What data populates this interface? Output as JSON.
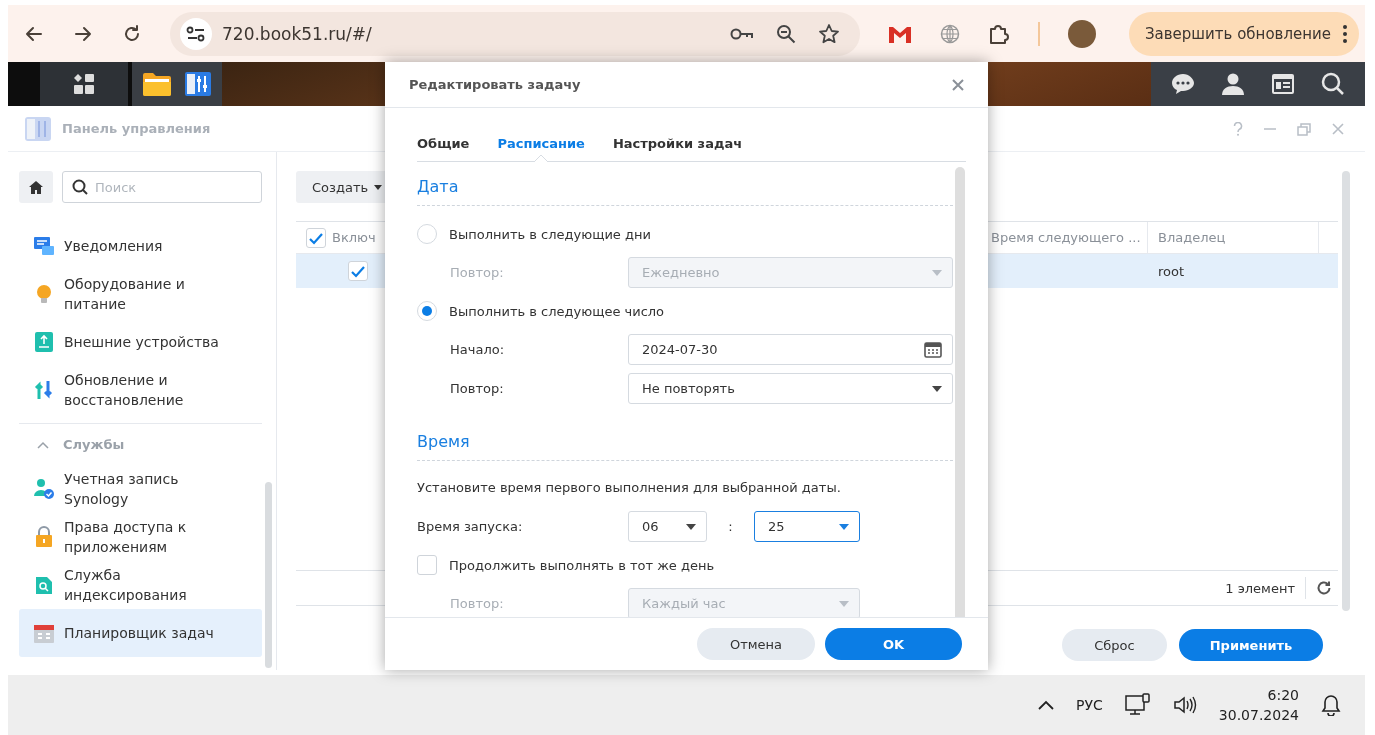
{
  "browser": {
    "url": "720.book51.ru/#/",
    "update_button": "Завершить обновление"
  },
  "control_panel": {
    "title": "Панель управления",
    "search": {
      "placeholder": "Поиск"
    },
    "sidebar": [
      {
        "kind": "item",
        "label": "Уведомления",
        "selected": false
      },
      {
        "kind": "item",
        "label": "Оборудование и питание",
        "selected": false
      },
      {
        "kind": "item",
        "label": "Внешние устройства",
        "selected": false
      },
      {
        "kind": "item",
        "label": "Обновление и восстановление",
        "selected": false
      },
      {
        "kind": "group",
        "label": "Службы",
        "expanded": true
      },
      {
        "kind": "item",
        "label": "Учетная запись Synology",
        "selected": false
      },
      {
        "kind": "item",
        "label": "Права доступа к приложениям",
        "selected": false
      },
      {
        "kind": "item",
        "label": "Служба индексирования",
        "selected": false
      },
      {
        "kind": "item",
        "label": "Планировщик задач",
        "selected": true
      }
    ],
    "create_button": "Создать",
    "table": {
      "header_checked": true,
      "columns": [
        "Включ",
        "Время следующего ...",
        "Владелец"
      ],
      "rows": [
        {
          "selected": true,
          "enabled": true,
          "owner": "root"
        }
      ],
      "footer": "1 элемент"
    },
    "reset_button": "Сброс",
    "apply_button": "Применить"
  },
  "dialog": {
    "title": "Редактировать задачу",
    "tabs": [
      {
        "label": "Общие",
        "selected": false
      },
      {
        "label": "Расписание",
        "selected": true
      },
      {
        "label": "Настройки задач",
        "selected": false
      }
    ],
    "date_section": {
      "heading": "Дата",
      "options": [
        {
          "label": "Выполнить в следующие дни",
          "selected": false,
          "fields": [
            {
              "kind": "select",
              "label": "Повтор:",
              "value": "Ежедневно",
              "disabled": true
            }
          ]
        },
        {
          "label": "Выполнить в следующее число",
          "selected": true,
          "fields": [
            {
              "kind": "date",
              "label": "Начало:",
              "value": "2024-07-30",
              "disabled": false
            },
            {
              "kind": "select",
              "label": "Повтор:",
              "value": "Не повторять",
              "disabled": false
            }
          ]
        }
      ]
    },
    "time_section": {
      "heading": "Время",
      "hint": "Установите время первого выполнения для выбранной даты.",
      "start_label": "Время запуска:",
      "hour": {
        "value": "06",
        "focused": false
      },
      "separator": ":",
      "minute": {
        "value": "25",
        "focused": true
      },
      "continue": {
        "label": "Продолжить выполнять в тот же день",
        "checked": false
      },
      "repeat": {
        "label": "Повтор:",
        "value": "Каждый час",
        "disabled": true
      }
    },
    "cancel_button": "Отмена",
    "ok_button": "OK"
  },
  "taskbar": {
    "language": "РУС",
    "time": "6:20",
    "date": "30.07.2024"
  }
}
